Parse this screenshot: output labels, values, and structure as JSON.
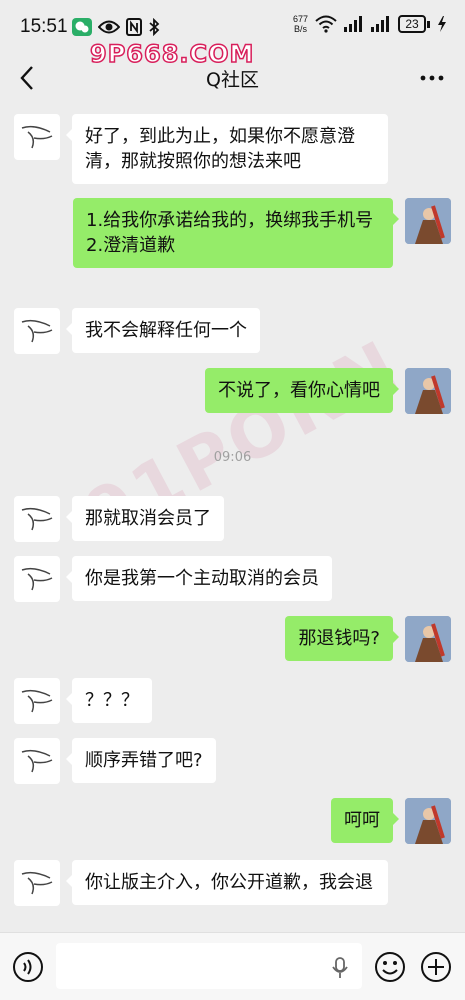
{
  "status_bar": {
    "time": "15:51",
    "net_speed_value": "677",
    "net_speed_unit": "B/s",
    "battery": "23",
    "icons": [
      "wechat-icon",
      "eye-icon",
      "nfc-icon",
      "bluetooth-icon",
      "wifi-icon",
      "signal-icon",
      "signal-icon",
      "battery-icon",
      "charging-icon"
    ]
  },
  "watermark": "9P668.COM",
  "diagonal_watermark": "91PORN",
  "header": {
    "title": "Q社区"
  },
  "messages": [
    {
      "side": "left",
      "text": "好了，到此为止，如果你不愿意澄清，那就按照你的想法来吧"
    },
    {
      "side": "right",
      "text": "1.给我你承诺给我的，换绑我手机号\n2.澄清道歉"
    },
    {
      "side": "left",
      "text": "我不会解释任何一个"
    },
    {
      "side": "right",
      "text": "不说了，看你心情吧"
    },
    {
      "side": "left",
      "text": "那就取消会员了"
    },
    {
      "side": "left",
      "text": "你是我第一个主动取消的会员"
    },
    {
      "side": "right",
      "text": "那退钱吗?"
    },
    {
      "side": "left",
      "text": "？？？"
    },
    {
      "side": "left",
      "text": "顺序弄错了吧?"
    },
    {
      "side": "right",
      "text": "呵呵"
    },
    {
      "side": "left",
      "text": "你让版主介入，你公开道歉，我会退"
    }
  ],
  "timestamp": "09:06",
  "colors": {
    "background": "#ededed",
    "my_bubble": "#95ec69",
    "their_bubble": "#ffffff",
    "watermark": "#d81f5b"
  }
}
